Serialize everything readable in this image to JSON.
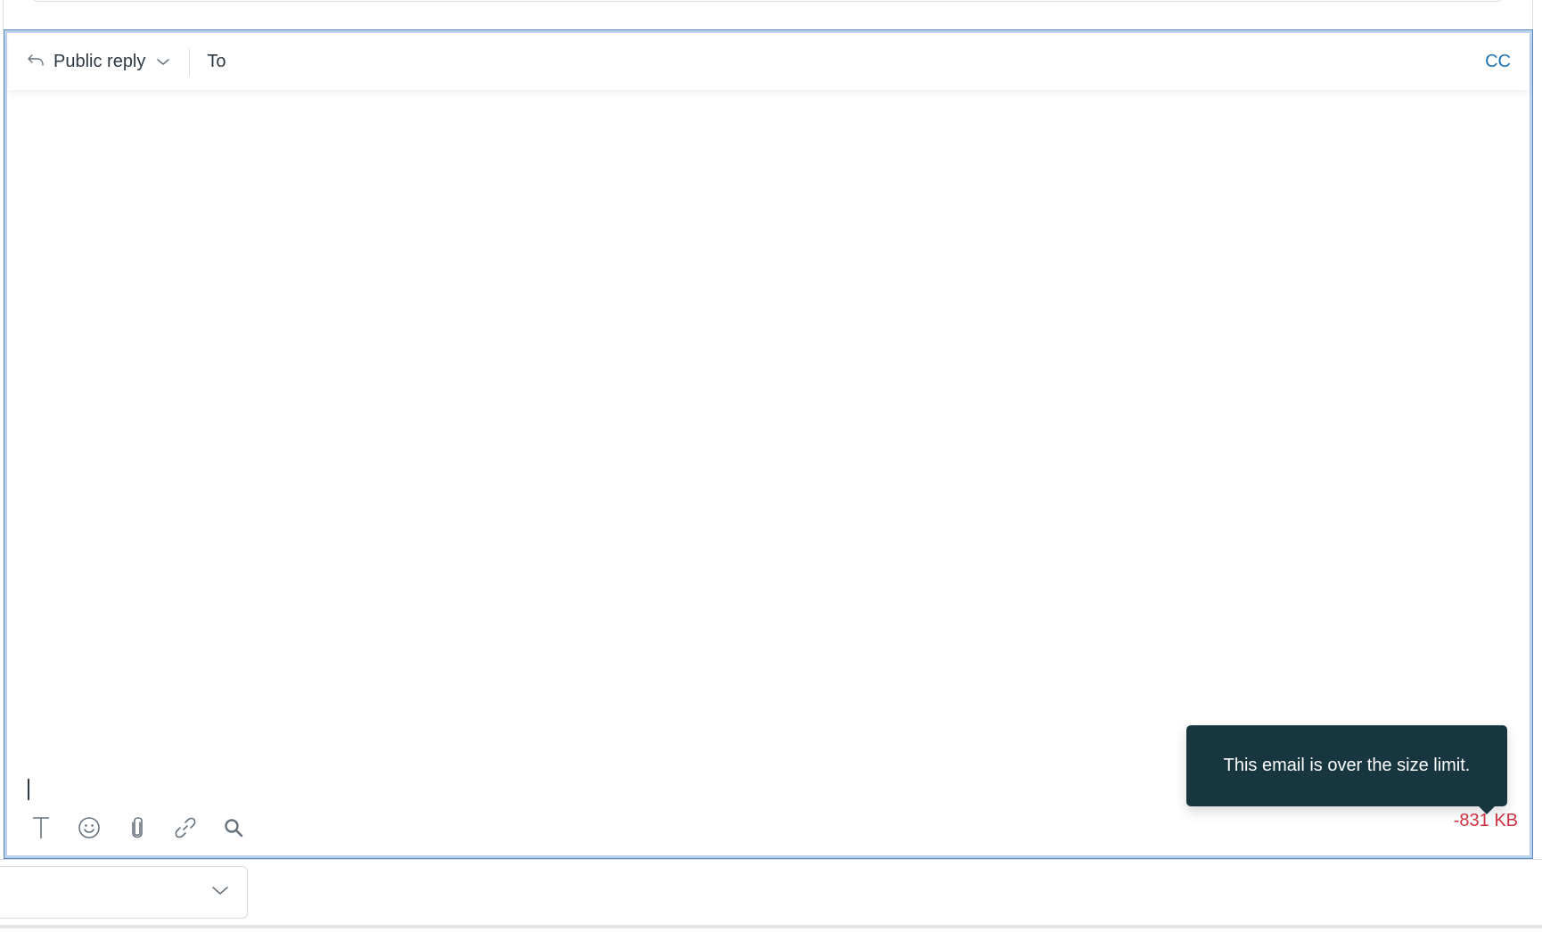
{
  "composer": {
    "reply_type": "Public reply",
    "to_label": "To",
    "cc_label": "CC",
    "body_text": "",
    "toolbar_icons": [
      "text-format-icon",
      "emoji-icon",
      "attachment-icon",
      "link-icon",
      "search-icon"
    ],
    "size_remaining": "-831 KB",
    "size_warning_tooltip": "This email is over the size limit."
  },
  "bottom_select": {
    "value": ""
  },
  "colors": {
    "accent": "#1f73b7",
    "error": "#cc3340",
    "tooltip_bg": "#17363f",
    "focus_border": "#5b8ac2"
  }
}
